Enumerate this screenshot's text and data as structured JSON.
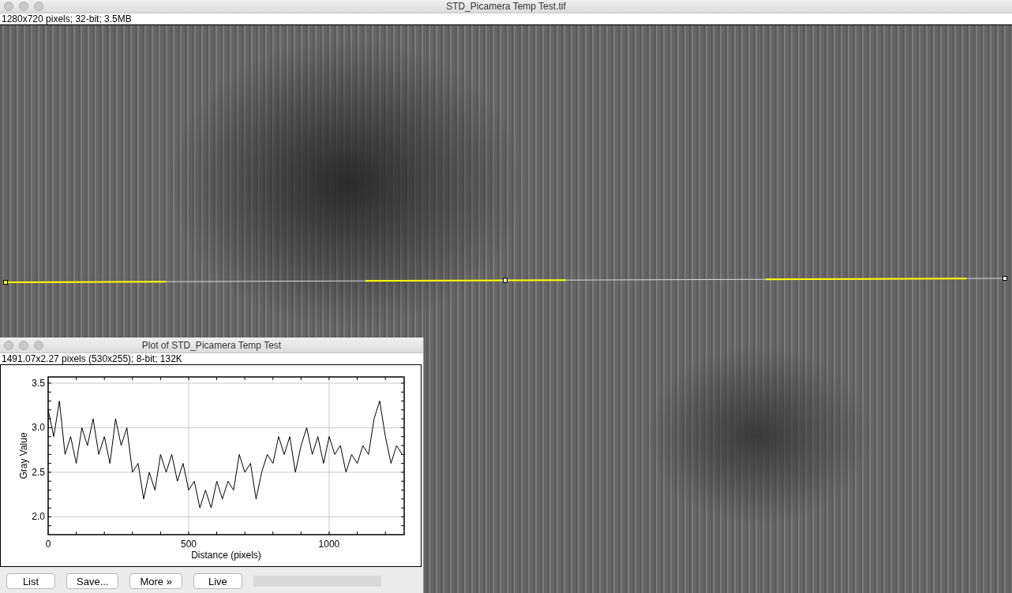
{
  "main_window": {
    "title": "STD_Picamera Temp Test.tif",
    "info": "1280x720 pixels; 32-bit; 3.5MB"
  },
  "plot_window": {
    "title": "Plot of STD_Picamera Temp Test",
    "info": "1491.07x2.27 pixels (530x255); 8-bit; 132K",
    "chart_data": {
      "type": "line",
      "grid": true,
      "xlabel": "Distance (pixels)",
      "ylabel": "Gray Value",
      "xlim": [
        0,
        1267
      ],
      "ylim": [
        1.8,
        3.57
      ],
      "xticks": [
        0,
        500,
        1000
      ],
      "yticks": [
        {
          "value": 2,
          "label": "2.0"
        },
        {
          "value": 2.5,
          "label": "2.5"
        },
        {
          "value": 3,
          "label": "3.0"
        },
        {
          "value": 3.5,
          "label": "3.5"
        }
      ],
      "x": [
        0,
        20,
        40,
        60,
        80,
        100,
        120,
        140,
        160,
        180,
        200,
        220,
        240,
        260,
        280,
        300,
        320,
        340,
        360,
        380,
        400,
        420,
        440,
        460,
        480,
        500,
        520,
        540,
        560,
        580,
        600,
        620,
        640,
        660,
        680,
        700,
        720,
        740,
        760,
        780,
        800,
        820,
        840,
        860,
        880,
        900,
        920,
        940,
        960,
        980,
        1000,
        1020,
        1040,
        1060,
        1080,
        1100,
        1120,
        1140,
        1160,
        1180,
        1200,
        1220,
        1240,
        1260
      ],
      "series": [
        {
          "color": "#000000",
          "values": [
            3.2,
            2.9,
            3.3,
            2.7,
            2.9,
            2.6,
            3.0,
            2.8,
            3.1,
            2.7,
            2.9,
            2.6,
            3.1,
            2.8,
            3.0,
            2.5,
            2.6,
            2.2,
            2.5,
            2.3,
            2.7,
            2.5,
            2.7,
            2.4,
            2.6,
            2.3,
            2.4,
            2.1,
            2.3,
            2.1,
            2.4,
            2.2,
            2.4,
            2.3,
            2.7,
            2.5,
            2.6,
            2.2,
            2.5,
            2.7,
            2.6,
            2.9,
            2.7,
            2.9,
            2.5,
            2.8,
            3.0,
            2.7,
            2.9,
            2.6,
            2.9,
            2.7,
            2.8,
            2.5,
            2.7,
            2.6,
            2.8,
            2.7,
            3.1,
            3.3,
            2.9,
            2.6,
            2.8,
            2.7
          ]
        }
      ]
    },
    "buttons": [
      "List",
      "Save...",
      "More »",
      "Live"
    ]
  }
}
